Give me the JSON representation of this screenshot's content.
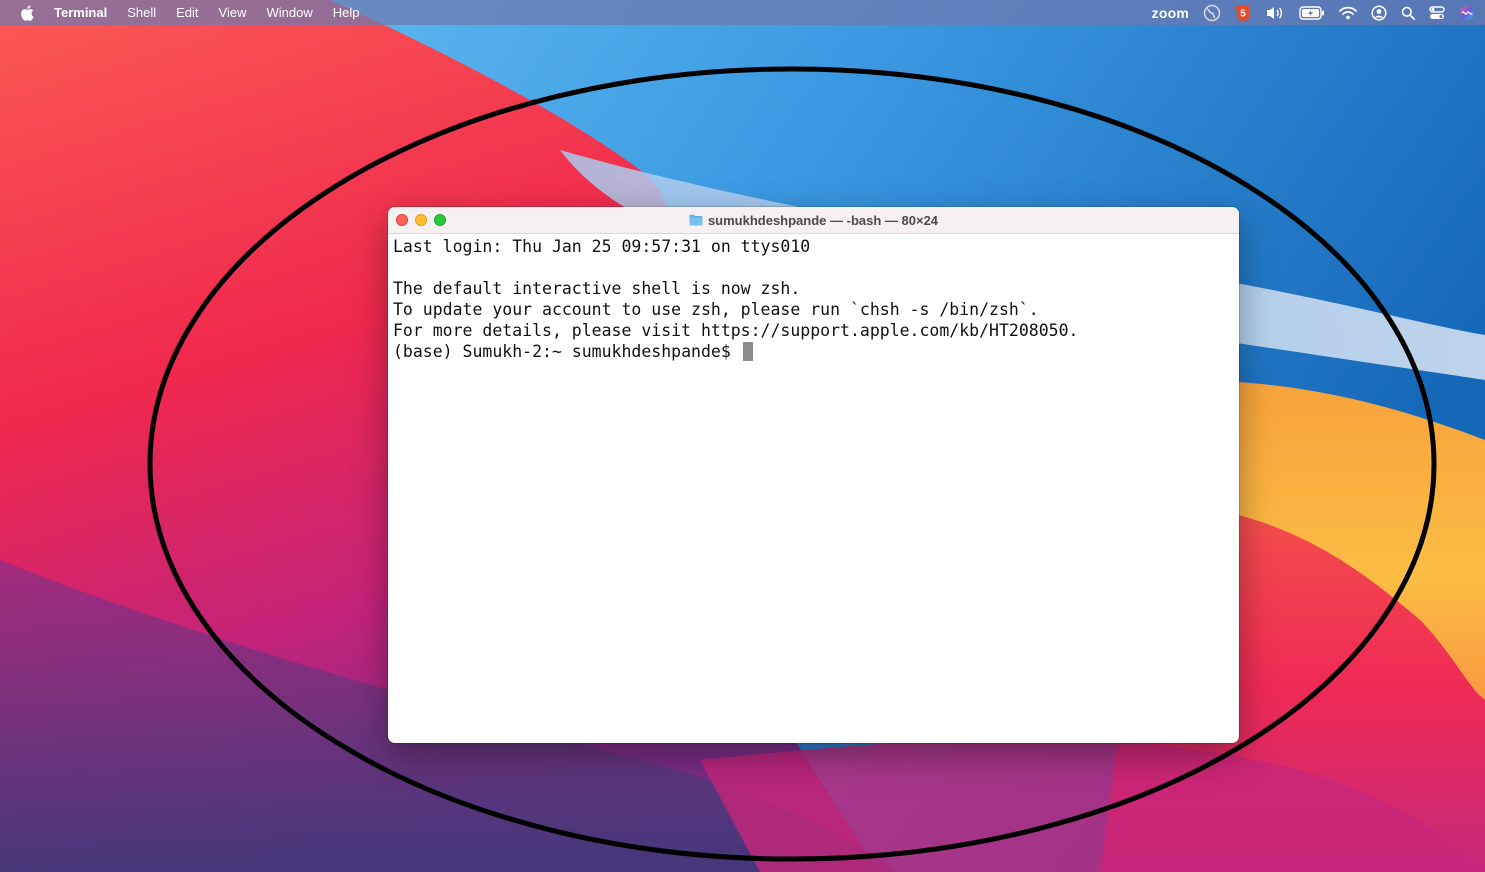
{
  "menubar": {
    "app_name": "Terminal",
    "items": [
      "Shell",
      "Edit",
      "View",
      "Window",
      "Help"
    ],
    "tray": {
      "zoom_label": "zoom",
      "icons": [
        "globe-icon",
        "html5-icon",
        "volume-icon",
        "battery-charging-icon",
        "wifi-icon",
        "user-icon",
        "search-icon",
        "control-center-icon",
        "siri-icon"
      ]
    }
  },
  "terminal": {
    "title": "sumukhdeshpande — -bash — 80×24",
    "lines": [
      "Last login: Thu Jan 25 09:57:31 on ttys010",
      "",
      "The default interactive shell is now zsh.",
      "To update your account to use zsh, please run `chsh -s /bin/zsh`.",
      "For more details, please visit https://support.apple.com/kb/HT208050.",
      "(base) Sumukh-2:~ sumukhdeshpande$ "
    ]
  },
  "colors": {
    "close": "#ff5f57",
    "minimize": "#febc2e",
    "maximize": "#28c840",
    "annotation": "#000000"
  }
}
